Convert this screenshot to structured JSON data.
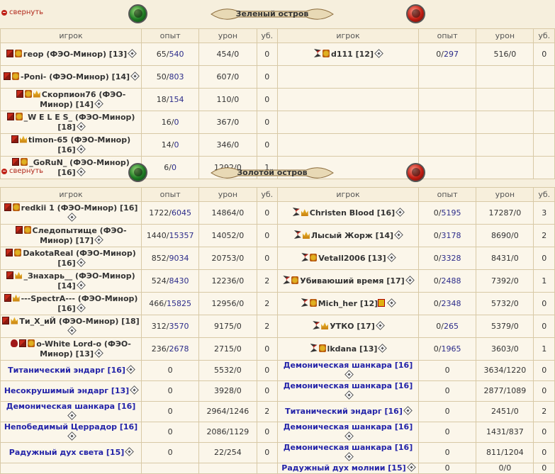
{
  "collapse_label": "свернуть",
  "headers": [
    "игрок",
    "опыт",
    "урон",
    "уб.",
    "игрок",
    "опыт",
    "урон",
    "уб."
  ],
  "sections": [
    {
      "title": "Зеленый остров",
      "rows": [
        {
          "left": {
            "name": "геор (ФЭО-Минор) [13]",
            "icons": [
              "fl",
              "rk"
            ],
            "exp_a": "65",
            "exp_b": "540",
            "dmg": "454/0",
            "kills": "0"
          },
          "right": {
            "name": "d111 [12]",
            "icons": [
              "sn",
              "rk"
            ],
            "exp_a": "0",
            "exp_b": "297",
            "dmg": "516/0",
            "kills": "0"
          }
        },
        {
          "left": {
            "name": "-Poni- (ФЭО-Минор) [14]",
            "icons": [
              "fl",
              "rk"
            ],
            "exp_a": "50",
            "exp_b": "803",
            "dmg": "607/0",
            "kills": "0"
          },
          "right": null
        },
        {
          "left": {
            "name": "Скорпион76 (ФЭО-Минор) [14]",
            "icons": [
              "fl",
              "rk",
              "cr"
            ],
            "exp_a": "18",
            "exp_b": "154",
            "dmg": "110/0",
            "kills": "0"
          },
          "right": null
        },
        {
          "left": {
            "name": "_W E L E S_ (ФЭО-Минор) [18]",
            "icons": [
              "fl",
              "rk"
            ],
            "exp_a": "16",
            "exp_b": "0",
            "dmg": "367/0",
            "kills": "0"
          },
          "right": null
        },
        {
          "left": {
            "name": "timon-65 (ФЭО-Минор) [16]",
            "icons": [
              "fl",
              "cr"
            ],
            "exp_a": "14",
            "exp_b": "0",
            "dmg": "346/0",
            "kills": "0"
          },
          "right": null
        },
        {
          "left": {
            "name": "_GoRuN_ (ФЭО-Минор) [16]",
            "icons": [
              "fl",
              "rk"
            ],
            "exp_a": "6",
            "exp_b": "0",
            "dmg": "1292/0",
            "kills": "1"
          },
          "right": null
        }
      ]
    },
    {
      "title": "Золотой остров",
      "rows": [
        {
          "left": {
            "name": "redkii 1 (ФЭО-Минор) [16]",
            "icons": [
              "fl",
              "rk"
            ],
            "exp_a": "1722",
            "exp_b": "6045",
            "dmg": "14864/0",
            "kills": "0"
          },
          "right": {
            "name": "Christen Blood [16]",
            "icons": [
              "sn",
              "cr"
            ],
            "exp_a": "0",
            "exp_b": "5195",
            "dmg": "17287/0",
            "kills": "3"
          }
        },
        {
          "left": {
            "name": "Следопытище (ФЭО-Минор) [17]",
            "icons": [
              "fl",
              "rk"
            ],
            "exp_a": "1440",
            "exp_b": "15357",
            "dmg": "14052/0",
            "kills": "0"
          },
          "right": {
            "name": "Лысый Жорж [14]",
            "icons": [
              "sn",
              "cr"
            ],
            "exp_a": "0",
            "exp_b": "3178",
            "dmg": "8690/0",
            "kills": "2"
          }
        },
        {
          "left": {
            "name": "DakotaReal (ФЭО-Минор) [16]",
            "icons": [
              "fl",
              "rk"
            ],
            "exp_a": "852",
            "exp_b": "9034",
            "dmg": "20753/0",
            "kills": "0"
          },
          "right": {
            "name": "Vetall2006 [13]",
            "icons": [
              "sn",
              "rk"
            ],
            "exp_a": "0",
            "exp_b": "3328",
            "dmg": "8431/0",
            "kills": "0"
          }
        },
        {
          "left": {
            "name": "_Знахарь__ (ФЭО-Минор) [14]",
            "icons": [
              "fl",
              "cr"
            ],
            "exp_a": "524",
            "exp_b": "8430",
            "dmg": "12236/0",
            "kills": "2"
          },
          "right": {
            "name": "Убиваюший время [17]",
            "icons": [
              "sn",
              "rk"
            ],
            "exp_a": "0",
            "exp_b": "2488",
            "dmg": "7392/0",
            "kills": "1"
          }
        },
        {
          "left": {
            "name": "---SpectrA--- (ФЭО-Минор) [16]",
            "icons": [
              "fl",
              "cr"
            ],
            "exp_a": "466",
            "exp_b": "15825",
            "dmg": "12956/0",
            "kills": "2"
          },
          "right": {
            "name": "Mich_her [12]",
            "icons": [
              "sn",
              "rk"
            ],
            "extra": "gem",
            "exp_a": "0",
            "exp_b": "2348",
            "dmg": "5732/0",
            "kills": "0"
          }
        },
        {
          "left": {
            "name": "Ти_Х_иЙ (ФЭО-Минор) [18]",
            "icons": [
              "fl",
              "cr"
            ],
            "exp_a": "312",
            "exp_b": "3570",
            "dmg": "9175/0",
            "kills": "2"
          },
          "right": {
            "name": "УТКО [17]",
            "icons": [
              "sn",
              "cr"
            ],
            "exp_a": "0",
            "exp_b": "265",
            "dmg": "5379/0",
            "kills": "0"
          }
        },
        {
          "left": {
            "name": "o-White Lord-o (ФЭО-Минор) [13]",
            "icons": [
              "sk",
              "fl",
              "rk"
            ],
            "exp_a": "236",
            "exp_b": "2678",
            "dmg": "2715/0",
            "kills": "0"
          },
          "right": {
            "name": "lkdana [13]",
            "icons": [
              "sn",
              "rk"
            ],
            "exp_a": "0",
            "exp_b": "1965",
            "dmg": "3603/0",
            "kills": "1"
          }
        }
      ],
      "npc_rows": [
        {
          "left": {
            "name": "Титанический эндарг [16]",
            "exp": "0",
            "dmg": "5532/0",
            "kills": "0"
          },
          "right": {
            "name": "Демоническая шанкара [16]",
            "exp": "0",
            "dmg": "3634/1220",
            "kills": "0"
          }
        },
        {
          "left": {
            "name": "Несокрушимый эндарг [13]",
            "exp": "0",
            "dmg": "3928/0",
            "kills": "0"
          },
          "right": {
            "name": "Демоническая шанкара [16]",
            "exp": "0",
            "dmg": "2877/1089",
            "kills": "0"
          }
        },
        {
          "left": {
            "name": "Демоническая шанкара [16]",
            "exp": "0",
            "dmg": "2964/1246",
            "kills": "2"
          },
          "right": {
            "name": "Титанический эндарг [16]",
            "exp": "0",
            "dmg": "2451/0",
            "kills": "2"
          }
        },
        {
          "left": {
            "name": "Непобедимый Церрадор [16]",
            "exp": "0",
            "dmg": "2086/1129",
            "kills": "0"
          },
          "right": {
            "name": "Демоническая шанкара [16]",
            "exp": "0",
            "dmg": "1431/837",
            "kills": "0"
          }
        },
        {
          "left": {
            "name": "Радужный дух света  [15]",
            "exp": "0",
            "dmg": "22/254",
            "kills": "0"
          },
          "right": {
            "name": "Демоническая шанкара [16]",
            "exp": "0",
            "dmg": "811/1204",
            "kills": "0"
          }
        },
        {
          "left": null,
          "right": {
            "name": "Радужный дух молнии  [15]",
            "exp": "0",
            "dmg": "0/0",
            "kills": "0"
          }
        }
      ]
    }
  ]
}
